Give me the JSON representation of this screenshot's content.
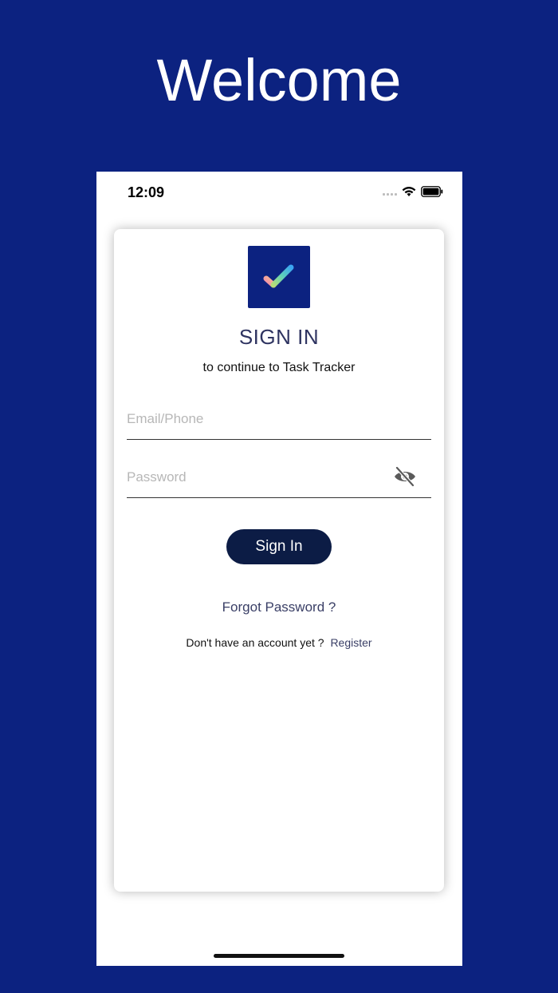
{
  "hero": {
    "title": "Welcome"
  },
  "status_bar": {
    "time": "12:09",
    "icons": [
      "signal-dots-icon",
      "wifi-icon",
      "battery-icon"
    ]
  },
  "login": {
    "logo_icon": "checkmark-logo-icon",
    "title": "SIGN IN",
    "subtitle": "to continue to Task Tracker",
    "email": {
      "value": "",
      "placeholder": "Email/Phone"
    },
    "password": {
      "value": "",
      "placeholder": "Password",
      "toggle_icon": "eye-off-icon"
    },
    "signin_label": "Sign In",
    "forgot_label": "Forgot Password ?",
    "register_prompt": "Don't have an account yet ?",
    "register_label": "Register"
  },
  "colors": {
    "background": "#0c2280",
    "button": "#0c1c45",
    "title_text": "#2f3461",
    "link_text": "#3a3f66"
  }
}
